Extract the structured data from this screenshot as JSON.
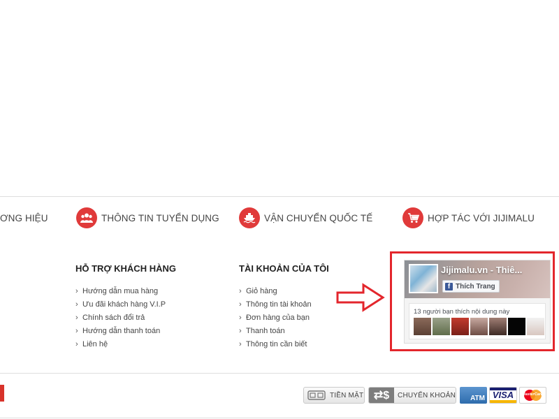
{
  "services": [
    {
      "label": "ƠNG HIỆU"
    },
    {
      "label": "THÔNG TIN TUYỂN DỤNG",
      "icon": "people-icon"
    },
    {
      "label": "VẬN CHUYỂN QUỐC TẾ",
      "icon": "ship-icon"
    },
    {
      "label": "HỢP TÁC VỚI JIJIMALU",
      "icon": "cart-icon"
    }
  ],
  "support": {
    "title": "HỖ TRỢ KHÁCH HÀNG",
    "items": [
      "Hướng dẫn mua hàng",
      "Ưu đãi khách hàng V.I.P",
      "Chính sách đổi trả",
      "Hướng dẫn thanh toán",
      "Liên hệ"
    ]
  },
  "account": {
    "title": "TÀI KHOẢN CỦA TÔI",
    "items": [
      "Giỏ hàng",
      "Thông tin tài khoản",
      "Đơn hàng của bạn",
      "Thanh toán",
      "Thông tin cần biết"
    ]
  },
  "facebook": {
    "page_name": "Jijimalu.vn - Thiê...",
    "like_label": "Thích Trang",
    "friends_text": "13 người bạn thích nội dung này",
    "brand_color": "#3b5998"
  },
  "payments": {
    "cash_label": "TIỀN MẶT",
    "transfer_label": "CHUYỂN KHOẢN",
    "atm_label": "ATM",
    "visa_label": "VISA",
    "mastercard_label": "MasterCard"
  },
  "colors": {
    "accent": "#e03a3a",
    "highlight": "#e3262c"
  }
}
